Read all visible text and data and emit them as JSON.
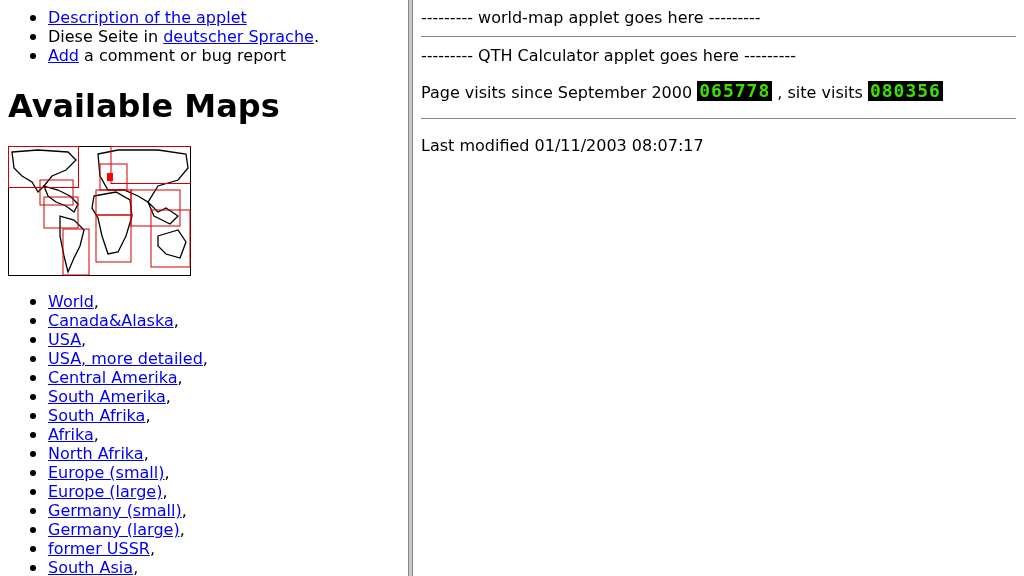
{
  "left_frame": {
    "top_links": [
      {
        "link": "Description of the applet"
      },
      {
        "before": "Diese Seite in ",
        "link": "deutscher Sprache",
        "after": "."
      },
      {
        "link": "Add",
        "after": " a comment or bug report"
      }
    ],
    "heading": "Available Maps",
    "maps": [
      {
        "label": "World",
        "after": ","
      },
      {
        "label": "Canada&Alaska",
        "after": ","
      },
      {
        "label": "USA",
        "after": ","
      },
      {
        "label": "USA, more detailed",
        "after": ","
      },
      {
        "label": "Central Amerika",
        "after": ","
      },
      {
        "label": "South Amerika",
        "after": ","
      },
      {
        "label": "South Afrika",
        "after": ","
      },
      {
        "label": "Afrika",
        "after": ","
      },
      {
        "label": "North Afrika",
        "after": ","
      },
      {
        "label": "Europe (small)",
        "after": ","
      },
      {
        "label": "Europe (large)",
        "after": ","
      },
      {
        "label": "Germany (small)",
        "after": ","
      },
      {
        "label": "Germany (large)",
        "after": ","
      },
      {
        "label": "former USSR",
        "after": ","
      },
      {
        "label": "South Asia",
        "after": ","
      }
    ]
  },
  "right_frame": {
    "world_map_placeholder": "--------- world-map applet goes here ---------",
    "qth_placeholder": "--------- QTH Calculator applet goes here ---------",
    "visits": {
      "page_label": "Page visits since September 2000",
      "page_counter": "065778",
      "site_label": ", site visits",
      "site_counter": "080356"
    },
    "last_modified": "Last modified 01/11/2003 08:07:17"
  }
}
